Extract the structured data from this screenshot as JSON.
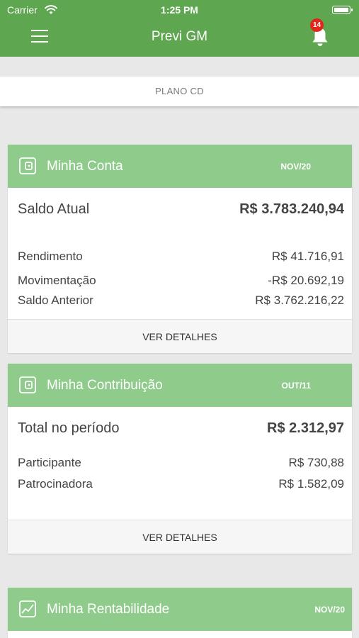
{
  "status_bar": {
    "carrier": "Carrier",
    "time": "1:25 PM"
  },
  "header": {
    "title": "Previ GM",
    "notification_count": "14"
  },
  "plan": {
    "label": "PLANO CD"
  },
  "conta": {
    "title": "Minha Conta",
    "period": "NOV/20",
    "main_label": "Saldo Atual",
    "main_value": "R$ 3.783.240,94",
    "rows": [
      {
        "label": "Rendimento",
        "value": "R$ 41.716,91"
      },
      {
        "label": "Movimentação",
        "value": "-R$ 20.692,19"
      },
      {
        "label": "Saldo Anterior",
        "value": "R$ 3.762.216,22"
      }
    ],
    "details_label": "VER DETALHES"
  },
  "contribuicao": {
    "title": "Minha Contribuição",
    "period": "OUT/11",
    "main_label": "Total no período",
    "main_value": "R$ 2.312,97",
    "rows": [
      {
        "label": "Participante",
        "value": "R$ 730,88"
      },
      {
        "label": "Patrocinadora",
        "value": "R$ 1.582,09"
      }
    ],
    "details_label": "VER DETALHES"
  },
  "rentabilidade": {
    "title": "Minha Rentabilidade",
    "period": "NOV/20"
  },
  "colors": {
    "header": "#5ea650",
    "card_header": "#8fcb8b",
    "badge": "#e1261c",
    "background": "#e8e8e8"
  }
}
